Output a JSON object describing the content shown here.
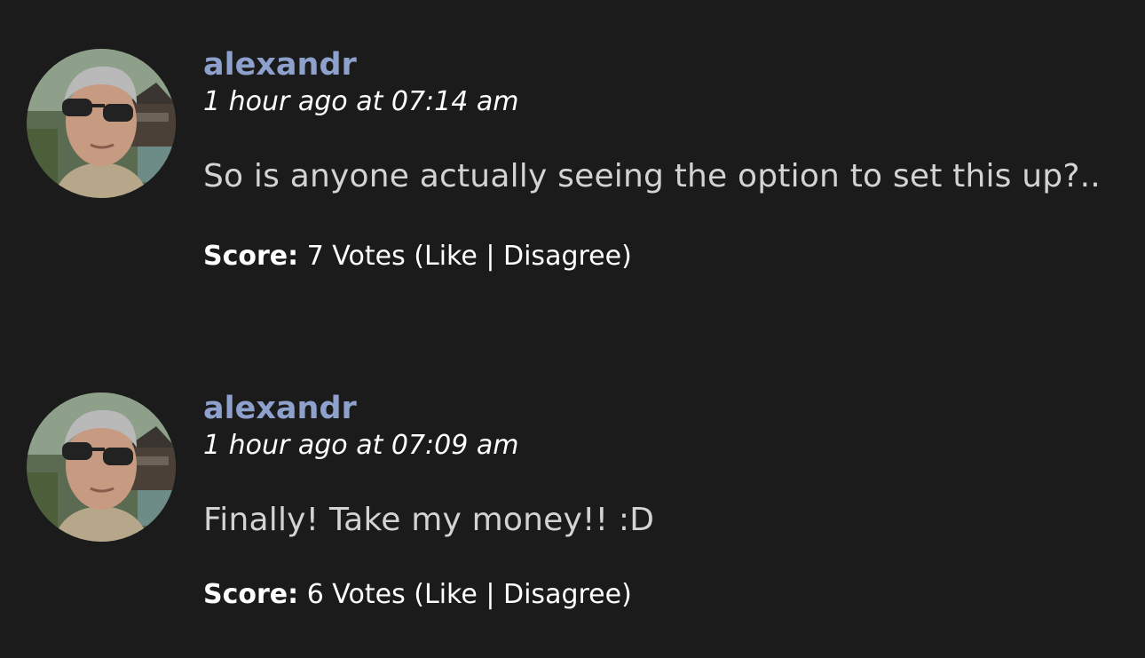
{
  "comments": [
    {
      "author": "alexandr",
      "timestamp": "1 hour ago at 07:14 am",
      "text": "So is anyone actually seeing the option to set this up?..",
      "score_label": "Score:",
      "votes": "7 Votes",
      "open_paren": "(",
      "like_label": "Like",
      "separator": "|",
      "disagree_label": "Disagree",
      "close_paren": ")"
    },
    {
      "author": "alexandr",
      "timestamp": "1 hour ago at 07:09 am",
      "text": "Finally! Take my money!! :D",
      "score_label": "Score:",
      "votes": "6 Votes",
      "open_paren": "(",
      "like_label": "Like",
      "separator": "|",
      "disagree_label": "Disagree",
      "close_paren": ")"
    }
  ],
  "colors": {
    "background": "#1b1b1b",
    "author": "#8ea1cd",
    "text": "#d3d3d3",
    "meta": "#ffffff"
  }
}
